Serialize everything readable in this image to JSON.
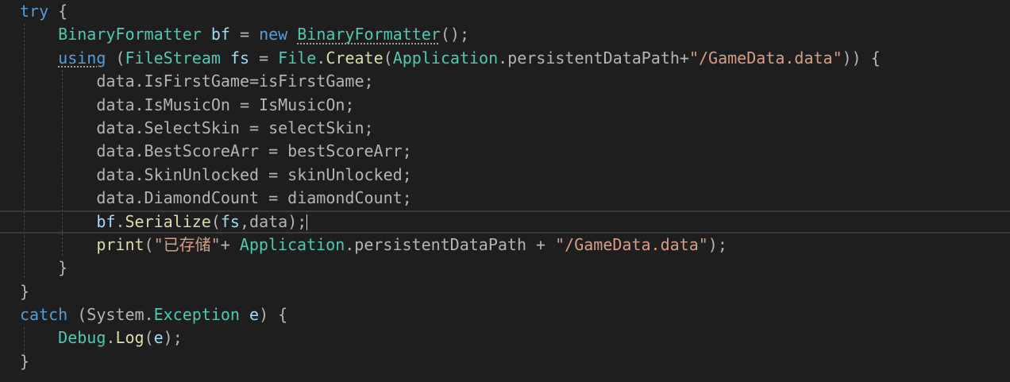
{
  "editor": {
    "language": "C#",
    "lines": [
      [
        {
          "c": "k",
          "t": "try"
        },
        {
          "c": "p",
          "t": " {"
        }
      ],
      [
        {
          "c": "p",
          "t": "    "
        },
        {
          "c": "t",
          "t": "BinaryFormatter"
        },
        {
          "c": "p",
          "t": " "
        },
        {
          "c": "v",
          "t": "bf"
        },
        {
          "c": "p",
          "t": " = "
        },
        {
          "c": "k",
          "t": "new"
        },
        {
          "c": "p",
          "t": " "
        },
        {
          "c": "t squiggle",
          "t": "BinaryFormatter"
        },
        {
          "c": "p",
          "t": "();"
        }
      ],
      [
        {
          "c": "p",
          "t": "    "
        },
        {
          "c": "k squiggle",
          "t": "using"
        },
        {
          "c": "p",
          "t": " ("
        },
        {
          "c": "t",
          "t": "FileStream"
        },
        {
          "c": "p",
          "t": " "
        },
        {
          "c": "v",
          "t": "fs"
        },
        {
          "c": "p",
          "t": " = "
        },
        {
          "c": "t",
          "t": "File"
        },
        {
          "c": "p",
          "t": "."
        },
        {
          "c": "m",
          "t": "Create"
        },
        {
          "c": "p",
          "t": "("
        },
        {
          "c": "t",
          "t": "Application"
        },
        {
          "c": "p",
          "t": ".persistentDataPath+"
        },
        {
          "c": "s",
          "t": "\"/GameData.data\""
        },
        {
          "c": "p",
          "t": ")) {"
        }
      ],
      [
        {
          "c": "p",
          "t": "        data."
        },
        {
          "c": "p",
          "t": "IsFirstGame=isFirstGame;"
        }
      ],
      [
        {
          "c": "p",
          "t": "        data."
        },
        {
          "c": "p",
          "t": "IsMusicOn = IsMusicOn;"
        }
      ],
      [
        {
          "c": "p",
          "t": "        data."
        },
        {
          "c": "p",
          "t": "SelectSkin = selectSkin;"
        }
      ],
      [
        {
          "c": "p",
          "t": "        data."
        },
        {
          "c": "p",
          "t": "BestScoreArr = bestScoreArr;"
        }
      ],
      [
        {
          "c": "p",
          "t": "        data."
        },
        {
          "c": "p",
          "t": "SkinUnlocked = skinUnlocked;"
        }
      ],
      [
        {
          "c": "p",
          "t": "        data."
        },
        {
          "c": "p",
          "t": "DiamondCount = diamondCount;"
        }
      ],
      [
        {
          "c": "p",
          "t": "        "
        },
        {
          "c": "v",
          "t": "bf"
        },
        {
          "c": "p",
          "t": "."
        },
        {
          "c": "m",
          "t": "Serialize"
        },
        {
          "c": "p",
          "t": "("
        },
        {
          "c": "v",
          "t": "fs"
        },
        {
          "c": "p",
          "t": ",data);"
        }
      ],
      [
        {
          "c": "p",
          "t": "        "
        },
        {
          "c": "m",
          "t": "print"
        },
        {
          "c": "p",
          "t": "("
        },
        {
          "c": "s",
          "t": "\"已存储\""
        },
        {
          "c": "p",
          "t": "+ "
        },
        {
          "c": "t",
          "t": "Application"
        },
        {
          "c": "p",
          "t": ".persistentDataPath + "
        },
        {
          "c": "s",
          "t": "\"/GameData.data\""
        },
        {
          "c": "p",
          "t": ");"
        }
      ],
      [
        {
          "c": "p",
          "t": "    }"
        }
      ],
      [
        {
          "c": "p",
          "t": "}"
        }
      ],
      [
        {
          "c": "k",
          "t": "catch"
        },
        {
          "c": "p",
          "t": " (System."
        },
        {
          "c": "t",
          "t": "Exception"
        },
        {
          "c": "p",
          "t": " "
        },
        {
          "c": "v",
          "t": "e"
        },
        {
          "c": "p",
          "t": ") {"
        }
      ],
      [
        {
          "c": "p",
          "t": "    "
        },
        {
          "c": "t",
          "t": "Debug"
        },
        {
          "c": "p",
          "t": "."
        },
        {
          "c": "m",
          "t": "Log"
        },
        {
          "c": "p",
          "t": "("
        },
        {
          "c": "v",
          "t": "e"
        },
        {
          "c": "p",
          "t": ");"
        }
      ],
      [
        {
          "c": "p",
          "t": "}"
        }
      ]
    ],
    "current_line": 9,
    "colors": {
      "background": "#1e1e1e",
      "keyword": "#569cd6",
      "type": "#4ec9b0",
      "string": "#d69d85",
      "variable": "#9cdcfe",
      "method": "#dcdcaa",
      "text": "#dcdcdc"
    }
  }
}
